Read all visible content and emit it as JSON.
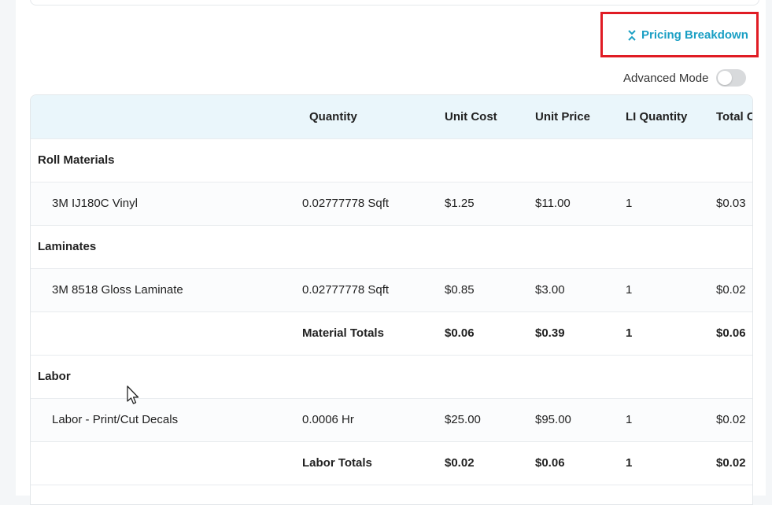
{
  "header": {
    "pricing_breakdown_label": "Pricing Breakdown",
    "advanced_mode_label": "Advanced Mode",
    "advanced_mode_on": false
  },
  "table": {
    "columns": [
      "",
      "Quantity",
      "Unit Cost",
      "Unit Price",
      "LI Quantity",
      "Total C"
    ],
    "sections": [
      {
        "title": "Roll Materials",
        "items": [
          {
            "name": "3M IJ180C Vinyl",
            "quantity": "0.02777778 Sqft",
            "unit_cost": "$1.25",
            "unit_price": "$11.00",
            "li_quantity": "1",
            "total": "$0.03"
          }
        ]
      },
      {
        "title": "Laminates",
        "items": [
          {
            "name": "3M 8518 Gloss Laminate",
            "quantity": "0.02777778 Sqft",
            "unit_cost": "$0.85",
            "unit_price": "$3.00",
            "li_quantity": "1",
            "total": "$0.02"
          }
        ]
      },
      {
        "totals": {
          "label": "Material Totals",
          "unit_cost": "$0.06",
          "unit_price": "$0.39",
          "li_quantity": "1",
          "total": "$0.06"
        }
      },
      {
        "title": "Labor",
        "items": [
          {
            "name": "Labor - Print/Cut Decals",
            "quantity": "0.0006 Hr",
            "unit_cost": "$25.00",
            "unit_price": "$95.00",
            "li_quantity": "1",
            "total": "$0.02"
          }
        ]
      },
      {
        "totals": {
          "label": "Labor Totals",
          "unit_cost": "$0.02",
          "unit_price": "$0.06",
          "li_quantity": "1",
          "total": "$0.02"
        }
      }
    ]
  },
  "colors": {
    "accent": "#1a9fc4",
    "highlight": "#e01c24",
    "header_bg": "#eaf6fb"
  }
}
